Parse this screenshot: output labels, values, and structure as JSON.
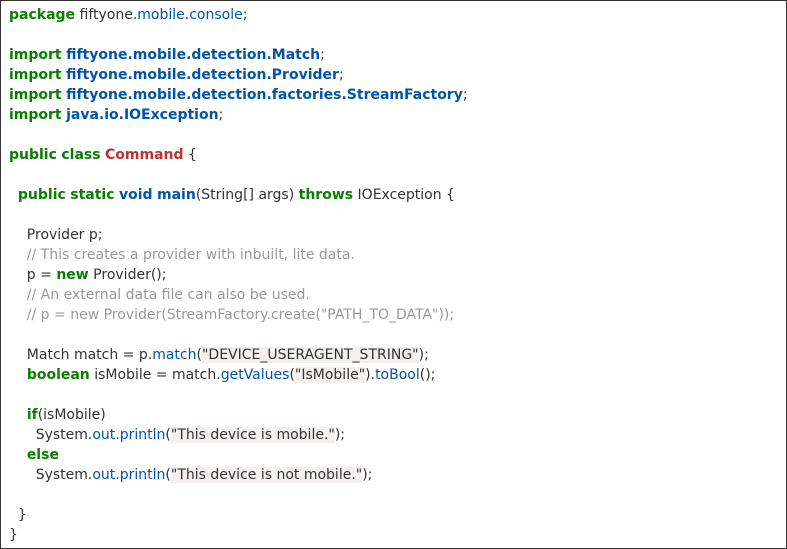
{
  "code": {
    "pkg_kw": "package",
    "pkg_prefix": " fiftyone.",
    "pkg_mobile": "mobile",
    "pkg_dot": ".",
    "pkg_console": "console",
    "semi": ";",
    "import_kw": "import",
    "sp": " ",
    "imp1": "fiftyone.mobile.detection.Match",
    "imp2": "fiftyone.mobile.detection.Provider",
    "imp3": "fiftyone.mobile.detection.factories.StreamFactory",
    "imp4": "java.io.IOException",
    "public_kw": "public",
    "class_kw": "class",
    "cmd": "Command",
    "open_brace": " {",
    "static_kw": "static",
    "void_kw": "void",
    "main_kw": "main",
    "main_args": "(String[] args) ",
    "throws_kw": "throws",
    "throws_rest": " IOException {",
    "provider_decl": "    Provider p;",
    "cmt1": "    // This creates a provider with inbuilt, lite data.",
    "p_assign_pre": "    p = ",
    "new_kw": "new",
    "p_assign_post": " Provider();",
    "cmt2": "    // An external data file can also be used.",
    "cmt3": "    // p = new Provider(StreamFactory.create(\"PATH_TO_DATA\"));",
    "match_pre": "    Match match = p.",
    "match_method": "match",
    "match_open": "(",
    "str_device": "\"DEVICE_USERAGENT_STRING\"",
    "match_close": ");",
    "boolean_kw": "boolean",
    "ismobile_pre": " isMobile = match.",
    "getvalues": "getValues",
    "gv_open": "(",
    "str_ismobile": "\"IsMobile\"",
    "gv_close": ").",
    "tobool": "toBool",
    "tobool_close": "();",
    "if_kw": "if",
    "if_cond": "(isMobile)",
    "sys_pre": "      System.",
    "out": "out",
    "dot": ".",
    "println": "println",
    "pl_open": "(",
    "str_mobile": "\"This device is mobile.\"",
    "pl_close": ");",
    "else_kw": "else",
    "str_notmobile": "\"This device is not mobile.\"",
    "close_inner": "  }",
    "close_outer": "}"
  }
}
